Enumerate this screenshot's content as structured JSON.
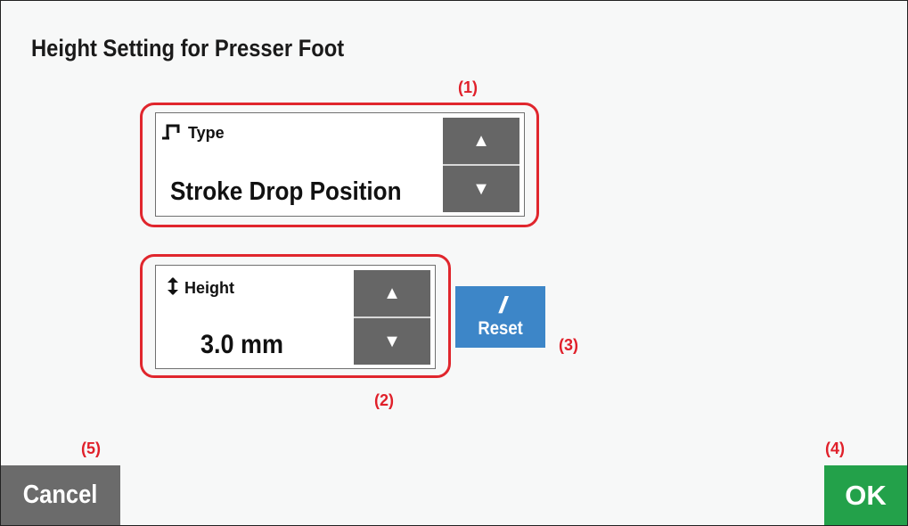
{
  "dialog": {
    "title": "Height Setting for Presser Foot"
  },
  "callouts": {
    "c1": "(1)",
    "c2": "(2)",
    "c3": "(3)",
    "c4": "(4)",
    "c5": "(5)"
  },
  "type_setting": {
    "icon": "presser-foot-icon",
    "label": "Type",
    "value": "Stroke Drop Position",
    "up_glyph": "▲",
    "down_glyph": "▼"
  },
  "height_setting": {
    "icon": "up-down-arrow-icon",
    "label": "Height",
    "value": "3.0 mm",
    "up_glyph": "▲",
    "down_glyph": "▼"
  },
  "reset_button": {
    "icon": "double-slash-icon",
    "glyph": "//",
    "label": "Reset"
  },
  "footer": {
    "cancel_label": "Cancel",
    "ok_label": "OK"
  },
  "colors": {
    "callout": "#e0202a",
    "stepper": "#666666",
    "reset": "#3d86c8",
    "cancel": "#6b6b6b",
    "ok": "#23a14a"
  }
}
